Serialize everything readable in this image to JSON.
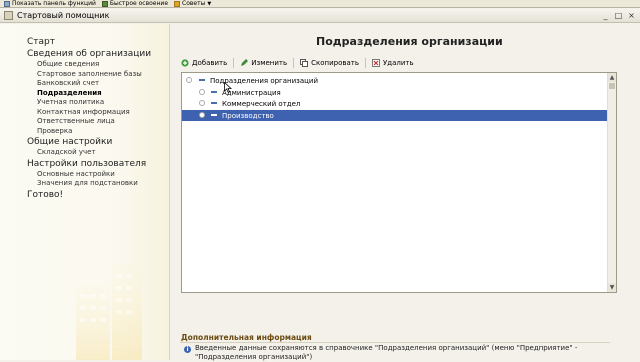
{
  "top_toolbar": {
    "items": [
      {
        "label": "Показать панель функций",
        "icon": "panel-icon"
      },
      {
        "label": "Быстрое освоение",
        "icon": "book-icon"
      },
      {
        "label": "Советы",
        "icon": "tips-icon"
      }
    ]
  },
  "window": {
    "title": "Стартовый помощник",
    "buttons": [
      "_",
      "□",
      "×"
    ]
  },
  "sidebar": {
    "nav": [
      {
        "label": "Старт",
        "level": 1
      },
      {
        "label": "Сведения об организации",
        "level": 1
      },
      {
        "label": "Общие сведения",
        "level": 2
      },
      {
        "label": "Стартовое заполнение базы",
        "level": 2
      },
      {
        "label": "Банковский счет",
        "level": 2
      },
      {
        "label": "Подразделения",
        "level": 2,
        "active": true
      },
      {
        "label": "Учетная политика",
        "level": 2
      },
      {
        "label": "Контактная информация",
        "level": 2
      },
      {
        "label": "Ответственные лица",
        "level": 2
      },
      {
        "label": "Проверка",
        "level": 2
      },
      {
        "label": "Общие настройки",
        "level": 1
      },
      {
        "label": "Складской учет",
        "level": 2
      },
      {
        "label": "Настройки пользователя",
        "level": 1
      },
      {
        "label": "Основные настройки",
        "level": 2
      },
      {
        "label": "Значения для подстановки",
        "level": 2
      },
      {
        "label": "Готово!",
        "level": 1
      }
    ]
  },
  "main": {
    "title": "Подразделения организации",
    "toolbar": {
      "add": "Добавить",
      "edit": "Изменить",
      "copy": "Скопировать",
      "delete": "Удалить"
    },
    "tree": [
      {
        "label": "Подразделения организаций",
        "level": 0
      },
      {
        "label": "Администрация",
        "level": 1
      },
      {
        "label": "Коммерческий отдел",
        "level": 1
      },
      {
        "label": "Производство",
        "level": 1,
        "selected": true
      }
    ],
    "info": {
      "title": "Дополнительная информация",
      "text": "Введенные данные сохраняются в справочнике \"Подразделения организаций\" (меню \"Предприятие\" - \"Подразделения организаций\")"
    }
  },
  "colors": {
    "selection": "#3e62b0",
    "info_title": "#6b4a12",
    "background": "#f3f1ea"
  }
}
